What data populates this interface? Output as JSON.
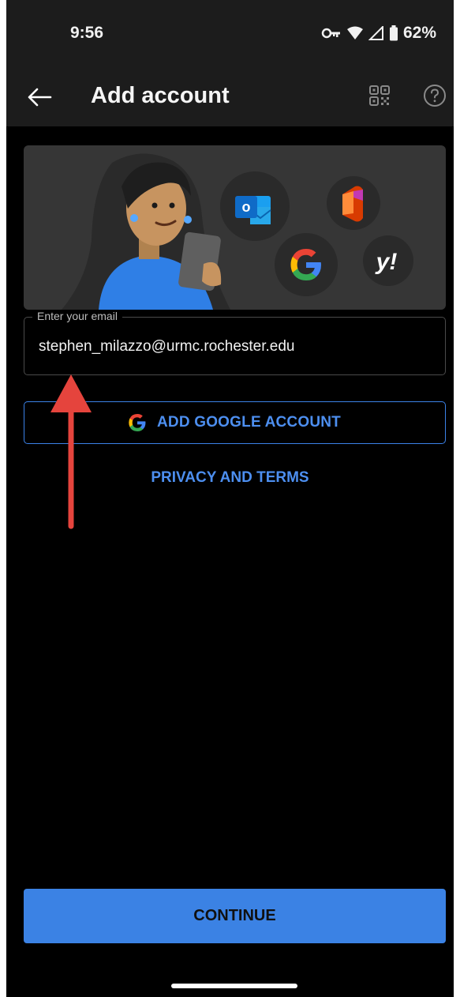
{
  "status_bar": {
    "time": "9:56",
    "battery": "62%",
    "icons": [
      "vpn-key-icon",
      "wifi-icon",
      "cellular-icon",
      "battery-icon"
    ]
  },
  "app_bar": {
    "title": "Add account",
    "icons": [
      "back-arrow-icon",
      "qr-code-icon",
      "help-icon"
    ]
  },
  "hero": {
    "provider_icons": [
      "outlook-icon",
      "office-icon",
      "google-icon",
      "yahoo-icon"
    ],
    "yahoo_glyph": "y!",
    "outlook_glyph": "o"
  },
  "email": {
    "label": "Enter your email",
    "value": "stephen_milazzo@urmc.rochester.edu"
  },
  "buttons": {
    "add_google": "ADD GOOGLE ACCOUNT",
    "privacy": "PRIVACY AND TERMS",
    "continue": "CONTINUE"
  },
  "colors": {
    "accent": "#3b82e4",
    "link": "#4d8ff0",
    "annotation_arrow": "#e5443d",
    "background": "#000000",
    "bar": "#1c1c1c"
  }
}
